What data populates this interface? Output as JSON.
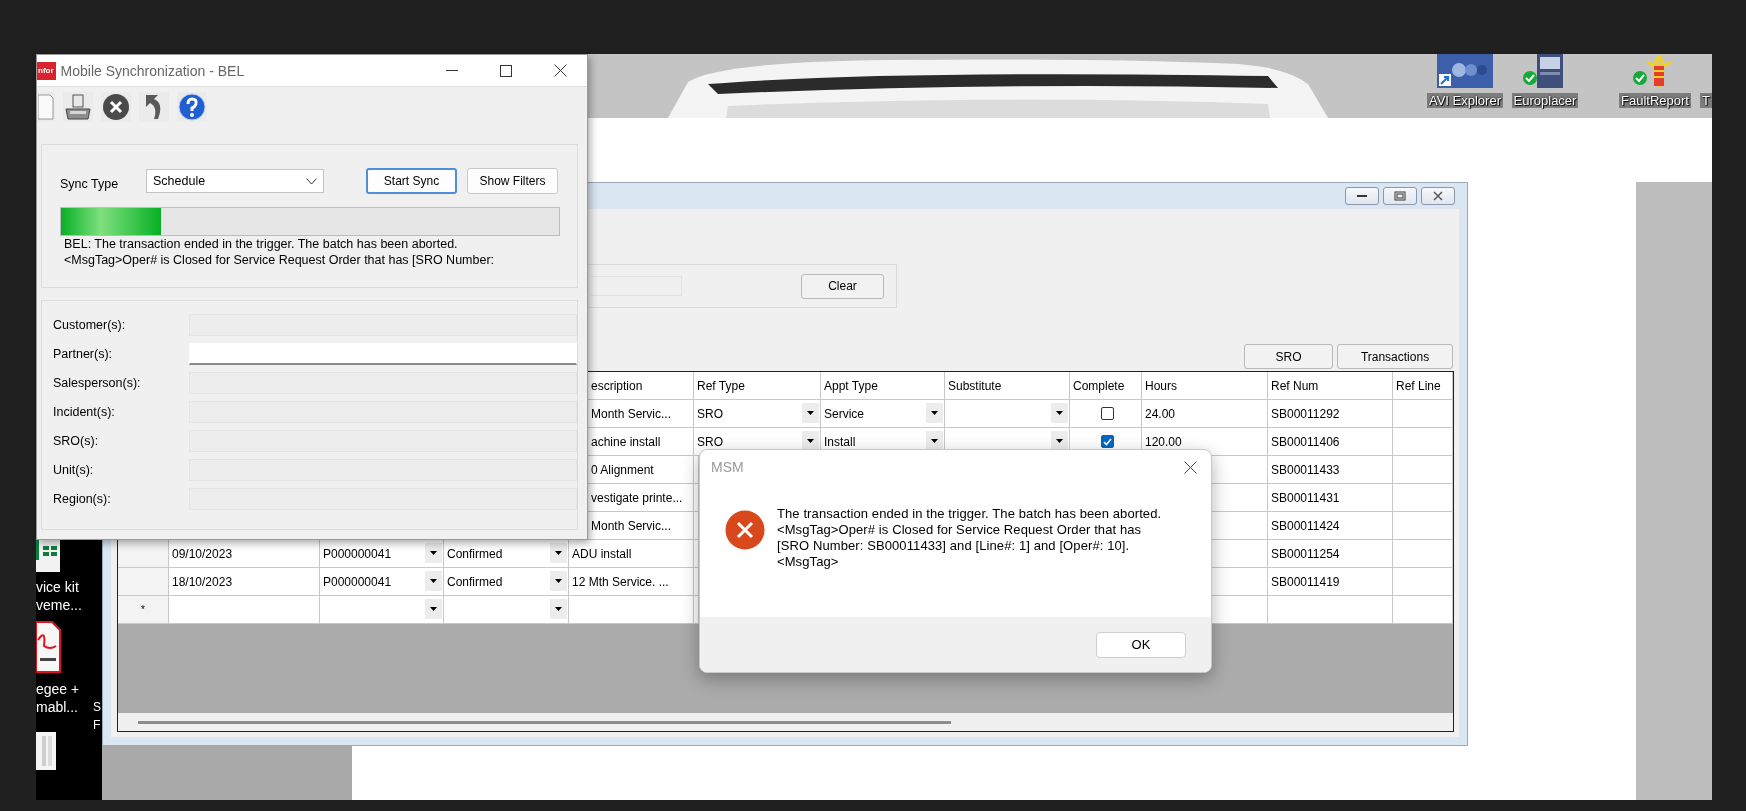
{
  "desktop": {
    "top_icons": [
      {
        "label": "AVI Explorer",
        "kind": "shortcut"
      },
      {
        "label": "Europlacer",
        "kind": "server"
      },
      {
        "label": "FaultReport",
        "kind": "fault"
      },
      {
        "label": "T",
        "kind": "cut"
      }
    ],
    "left_icons": [
      {
        "kind": "sheet",
        "lines": [
          "vice kit",
          "veme..."
        ]
      },
      {
        "kind": "pdf",
        "lines": [
          "egee +",
          "mabl..."
        ]
      },
      {
        "kind": "document"
      }
    ],
    "edge_labels": [
      "S",
      "F"
    ]
  },
  "main_window": {
    "clear_button": "Clear",
    "buttons": [
      "SRO",
      "Transactions"
    ],
    "table": {
      "columns": [
        "escription",
        "Ref Type",
        "Appt Type",
        "Substitute",
        "Complete",
        "Hours",
        "Ref Num",
        "Ref Line"
      ],
      "rows": [
        {
          "kind": "data",
          "description": "Month Servic...",
          "ref_type": "SRO",
          "appt_type": "Service",
          "complete": false,
          "hours": "24.00",
          "ref_num": "SB00011292"
        },
        {
          "kind": "data",
          "description": "achine install",
          "ref_type": "SRO",
          "appt_type": "Install",
          "complete": true,
          "hours": "120.00",
          "ref_num": "SB00011406"
        },
        {
          "kind": "data",
          "description": "0 Alignment",
          "ref_num": "SB00011433"
        },
        {
          "kind": "data",
          "description": "vestigate printe...",
          "ref_num": "SB00011431"
        },
        {
          "kind": "data",
          "description": "Month Servic...",
          "ref_num": "SB00011424"
        },
        {
          "kind": "data",
          "date": "09/10/2023",
          "partner": "P000000041",
          "status": "Confirmed",
          "description": "ADU install",
          "ref_num": "SB00011254"
        },
        {
          "kind": "data",
          "date": "18/10/2023",
          "partner": "P000000041",
          "status": "Confirmed",
          "description": "12 Mth Service. ...",
          "ref_num": "SB00011419"
        },
        {
          "kind": "new",
          "marker": "*"
        }
      ]
    }
  },
  "sync_window": {
    "logo": "nfor",
    "title": "Mobile Synchronization - BEL",
    "toolbar": [
      {
        "kind": "document"
      },
      {
        "kind": "printer"
      },
      {
        "kind": "cancel"
      },
      {
        "kind": "undo"
      },
      {
        "kind": "help"
      }
    ],
    "sync_type_label": "Sync Type",
    "sync_type": "Schedule",
    "buttons": [
      {
        "label": "Start Sync",
        "default": true
      },
      {
        "label": "Show Filters",
        "default": false
      }
    ],
    "progress": {
      "level": 0.2
    },
    "messages": [
      "BEL: The transaction ended in the trigger. The batch has been aborted.",
      "<MsgTag>Oper# is Closed for Service Request Order that has [SRO Number:"
    ],
    "filters": [
      {
        "label": "Customer(s):",
        "enabled": false
      },
      {
        "label": "Partner(s):",
        "enabled": true
      },
      {
        "label": "Salesperson(s):",
        "enabled": false
      },
      {
        "label": "Incident(s):",
        "enabled": false
      },
      {
        "label": "SRO(s):",
        "enabled": false
      },
      {
        "label": "Unit(s):",
        "enabled": false
      },
      {
        "label": "Region(s):",
        "enabled": false
      }
    ]
  },
  "dialog": {
    "title": "MSM",
    "messages": [
      "The transaction ended in the trigger. The batch has been aborted.",
      "<MsgTag>Oper# is Closed for Service Request Order that has [SRO Number: SB00011433] and [Line#: 1] and [Oper#: 10].<MsgTag>"
    ],
    "button": "OK"
  }
}
